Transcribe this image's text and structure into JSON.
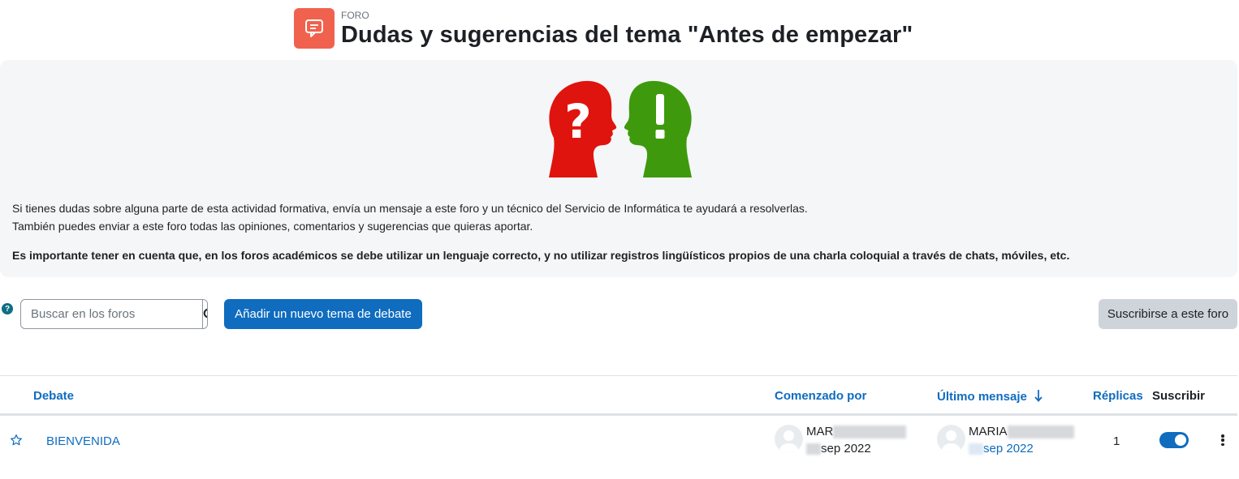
{
  "header": {
    "pre_title": "FORO",
    "title": "Dudas y sugerencias del tema \"Antes de empezar\""
  },
  "intro": {
    "paragraph_line1": "Si tienes dudas sobre alguna parte de esta actividad formativa, envía un mensaje a este foro y un técnico del Servicio de Informática te ayudará a resolverlas.",
    "paragraph_line2": "También puedes enviar a este foro todas las opiniones, comentarios y sugerencias que quieras aportar.",
    "bold_note": "Es importante tener en cuenta que, en los foros académicos se debe utilizar un lenguaje correcto, y no utilizar registros lingüísticos propios de una charla coloquial a través de chats, móviles, etc.",
    "image_icons": [
      "question-mark-head-icon",
      "exclamation-mark-head-icon"
    ]
  },
  "toolbar": {
    "help_icon": "question-circle-icon",
    "search_placeholder": "Buscar en los foros",
    "search_icon": "search-icon",
    "add_button": "Añadir un nuevo tema de debate",
    "subscribe_button": "Suscribirse a este foro"
  },
  "table": {
    "headers": {
      "debate": "Debate",
      "started_by": "Comenzado por",
      "last_post": "Último mensaje",
      "last_post_sort_icon": "arrow-down-icon",
      "replies": "Réplicas",
      "subscribe": "Suscribir"
    },
    "rows": [
      {
        "star_icon": "star-outline-icon",
        "title": "BIENVENIDA",
        "started_by_name": "MAR",
        "started_by_date": "sep 2022",
        "last_post_name": "MARIA",
        "last_post_date": "sep 2022",
        "replies": "1",
        "subscribed": true,
        "menu_icon": "kebab-menu-icon"
      }
    ]
  },
  "colors": {
    "primary": "#0f6cbf",
    "forum_icon_bg": "#f0624e",
    "head_red": "#e0140e",
    "head_green": "#3e9a0c"
  }
}
